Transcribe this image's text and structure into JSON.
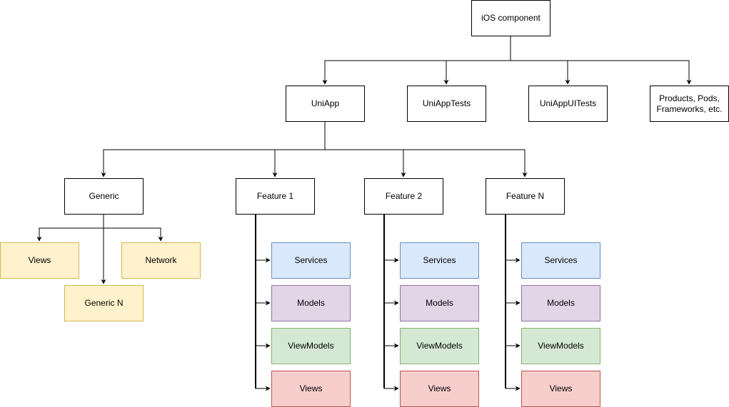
{
  "diagram": {
    "root": {
      "id": "ios",
      "label": "iOS component"
    },
    "targets": [
      {
        "id": "uniapp",
        "label": "UniApp"
      },
      {
        "id": "uniapptests",
        "label": "UniAppTests"
      },
      {
        "id": "uniappuitests",
        "label": "UniAppUITests"
      },
      {
        "id": "products",
        "label": "Products, Pods,\nFrameworks, etc."
      }
    ],
    "modules": [
      {
        "id": "generic",
        "label": "Generic"
      },
      {
        "id": "feature1",
        "label": "Feature 1"
      },
      {
        "id": "feature2",
        "label": "Feature 2"
      },
      {
        "id": "featureN",
        "label": "Feature N"
      }
    ],
    "generic_children": [
      {
        "id": "g_views",
        "label": "Views"
      },
      {
        "id": "g_network",
        "label": "Network"
      },
      {
        "id": "g_genericN",
        "label": "Generic N"
      }
    ],
    "feature_children": [
      {
        "label": "Services",
        "color": "blue"
      },
      {
        "label": "Models",
        "color": "purple"
      },
      {
        "label": "ViewModels",
        "color": "green"
      },
      {
        "label": "Views",
        "color": "red"
      }
    ],
    "palette": {
      "white": {
        "fill": "#ffffff",
        "stroke": "#000000"
      },
      "yellow": {
        "fill": "#fff2cc",
        "stroke": "#d6b656"
      },
      "blue": {
        "fill": "#dae8fc",
        "stroke": "#6c8ebf"
      },
      "purple": {
        "fill": "#e1d5e7",
        "stroke": "#9673a6"
      },
      "green": {
        "fill": "#d5e8d4",
        "stroke": "#82b366"
      },
      "red": {
        "fill": "#f8cecc",
        "stroke": "#b85450"
      }
    },
    "edges": [
      [
        "ios",
        "uniapp"
      ],
      [
        "ios",
        "uniapptests"
      ],
      [
        "ios",
        "uniappuitests"
      ],
      [
        "ios",
        "products"
      ],
      [
        "uniapp",
        "generic"
      ],
      [
        "uniapp",
        "feature1"
      ],
      [
        "uniapp",
        "feature2"
      ],
      [
        "uniapp",
        "featureN"
      ],
      [
        "generic",
        "g_views"
      ],
      [
        "generic",
        "g_network"
      ],
      [
        "generic",
        "g_genericN"
      ],
      [
        "feature1",
        "children"
      ],
      [
        "feature2",
        "children"
      ],
      [
        "featureN",
        "children"
      ]
    ]
  }
}
